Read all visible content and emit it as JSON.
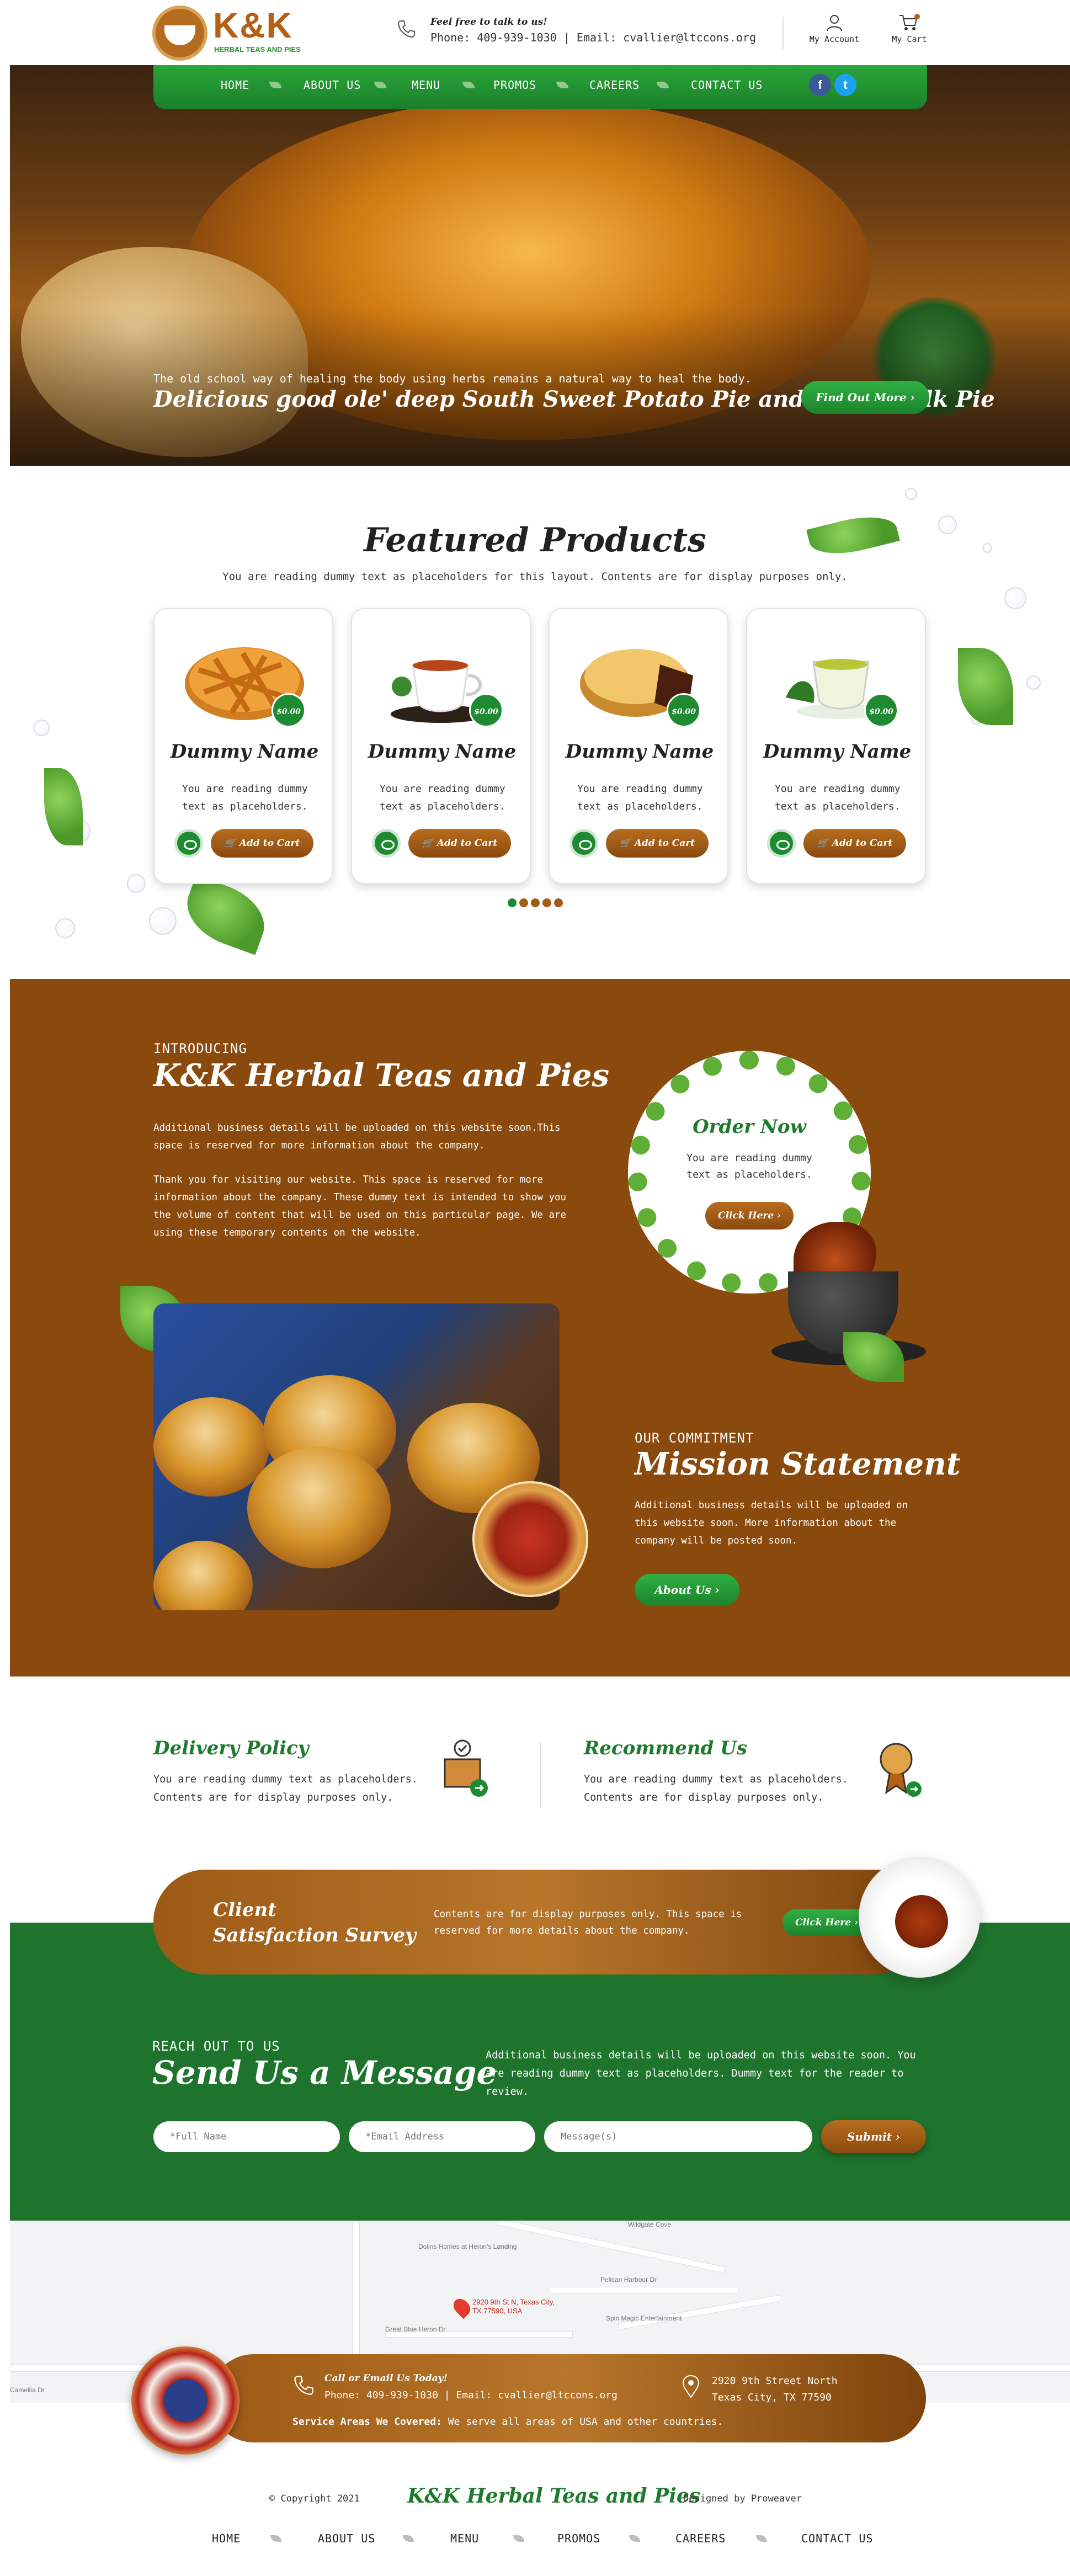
{
  "brand": {
    "name": "K&K",
    "tagline": "HERBAL TEAS AND PIES",
    "full_name": "K&K Herbal Teas and Pies",
    "colors": {
      "green": "#1e8a31",
      "brown": "#8a4a0e",
      "dark_green": "#1e742d"
    }
  },
  "header": {
    "contact_title": "Feel free to talk to us!",
    "contact_line": "Phone: 409-939-1030 | Email: cvallier@ltccons.org",
    "account_label": "My Account",
    "cart_label": "My Cart",
    "cart_count": "0"
  },
  "nav": {
    "items": [
      "HOME",
      "ABOUT US",
      "MENU",
      "PROMOS",
      "CAREERS",
      "CONTACT US"
    ],
    "social": [
      "facebook",
      "twitter"
    ]
  },
  "hero": {
    "subtitle": "The old school way of healing the body using herbs remains a natural way to heal the body.",
    "title": "Delicious good ole' deep South Sweet Potato Pie and Buttermilk Pie",
    "button": "Find Out More ›"
  },
  "featured": {
    "title": "Featured Products",
    "description": "You are reading dummy text as placeholders for this layout. Contents are for display purposes only.",
    "products": [
      {
        "name": "Dummy Name",
        "price": "$0.00",
        "description": "You are reading dummy text as placeholders.",
        "cart_label": "Add to Cart",
        "icon": "lattice-pie-icon"
      },
      {
        "name": "Dummy Name",
        "price": "$0.00",
        "description": "You are reading dummy text as placeholders.",
        "cart_label": "Add to Cart",
        "icon": "tea-cup-icon"
      },
      {
        "name": "Dummy Name",
        "price": "$0.00",
        "description": "You are reading dummy text as placeholders.",
        "cart_label": "Add to Cart",
        "icon": "meat-pie-icon"
      },
      {
        "name": "Dummy Name",
        "price": "$0.00",
        "description": "You are reading dummy text as placeholders.",
        "cart_label": "Add to Cart",
        "icon": "green-tea-icon"
      }
    ],
    "pagination_count": 5,
    "pagination_active": 1
  },
  "intro": {
    "eyebrow": "INTRODUCING",
    "title": "K&K Herbal Teas and Pies",
    "p1": "Additional business details will be uploaded on this website soon.This space is reserved for more information about the company.",
    "p2": "Thank you for visiting our website. This space is reserved for more information about the company. These dummy text is intended to show you the volume of content that will be used on this particular page. We are using these temporary contents on the website."
  },
  "order": {
    "title": "Order Now",
    "description": "You are reading dummy text as placeholders.",
    "button": "Click Here ›"
  },
  "mission": {
    "eyebrow": "OUR COMMITMENT",
    "title": "Mission Statement",
    "description": "Additional business details will be uploaded on this website soon. More information about the company will be posted soon.",
    "button": "About Us ›"
  },
  "policies": [
    {
      "title": "Delivery Policy",
      "description": "You are reading dummy text as placeholders. Contents are for display purposes only."
    },
    {
      "title": "Recommend Us",
      "description": "You are reading dummy text as placeholders. Contents are for display purposes only."
    }
  ],
  "survey": {
    "title_line1": "Client",
    "title_line2": "Satisfaction Survey",
    "description": "Contents are for display purposes only. This space is reserved for more details about the company.",
    "button": "Click Here ›"
  },
  "message": {
    "eyebrow": "REACH OUT TO US",
    "title": "Send Us a Message",
    "description": "Additional business details will be uploaded on this website soon. You are reading dummy text as placeholders. Dummy text for the reader to review.",
    "placeholders": {
      "name": "*Full Name",
      "email": "*Email Address",
      "message": "Message(s)"
    },
    "submit": "Submit ›"
  },
  "map": {
    "labels": [
      "Dolins Homes at Heron's Landing",
      "Wildgate Cove",
      "Pelican Harbour Dr",
      "Spin Magic Entertainment",
      "Great Blue Heron Dr",
      "Camellia Dr"
    ],
    "pin_label": "2920 9th St N, Texas City, TX 77590, USA"
  },
  "footer_bar": {
    "contact_title": "Call or Email Us Today!",
    "contact_line": "Phone: 409-939-1030 | Email: cvallier@ltccons.org",
    "address_line1": "2920 9th Street North",
    "address_line2": "Texas City, TX 77590",
    "service_label": "Service Areas We Covered:",
    "service_text": "We serve all areas of USA and other countries."
  },
  "copyright": {
    "text": "© Copyright 2021",
    "brand": "K&K Herbal Teas and Pies",
    "designed": "Designed by Proweaver"
  },
  "footer_nav": [
    "HOME",
    "ABOUT US",
    "MENU",
    "PROMOS",
    "CAREERS",
    "CONTACT US"
  ]
}
